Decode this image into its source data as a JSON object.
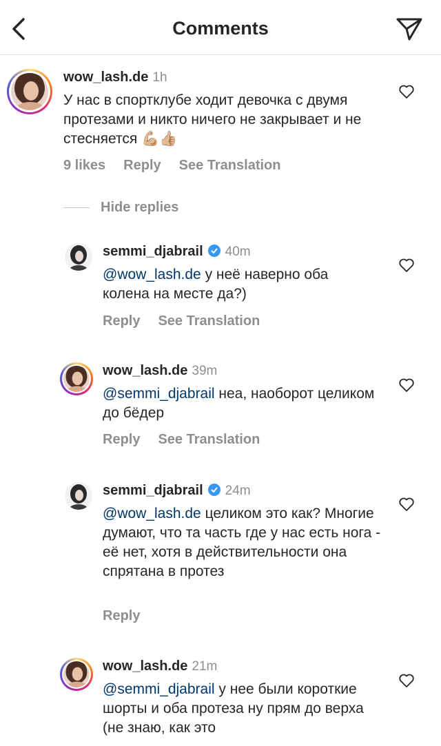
{
  "header": {
    "title": "Comments"
  },
  "main_comment": {
    "username": "wow_lash.de",
    "time": "1h",
    "text": "У нас в спортклубе ходит девочка с двумя протезами и никто ничего не закрывает и не стесняется 💪🏼👍🏼",
    "likes": "9 likes",
    "reply": "Reply",
    "see_translation": "See Translation"
  },
  "hide_replies": "Hide replies",
  "replies": [
    {
      "username": "semmi_djabrail",
      "time": "40m",
      "mention": "@wow_lash.de",
      "text": " у неё наверно оба колена на месте да?)",
      "reply": "Reply",
      "see_translation": "See Translation"
    },
    {
      "username": "wow_lash.de",
      "time": "39m",
      "mention": "@semmi_djabrail",
      "text": " неа, наоборот целиком до бёдер",
      "reply": "Reply",
      "see_translation": "See Translation"
    },
    {
      "username": "semmi_djabrail",
      "time": "24m",
      "mention": "@wow_lash.de",
      "text": " целиком это как? Многие думают, что та часть где у нас есть нога - её нет, хотя в действительности она спрятана в протез",
      "reply": "Reply"
    },
    {
      "username": "wow_lash.de",
      "time": "21m",
      "mention": "@semmi_djabrail",
      "text": " у нее были короткие шорты и оба протеза ну прям до верха (не знаю, как это"
    }
  ]
}
